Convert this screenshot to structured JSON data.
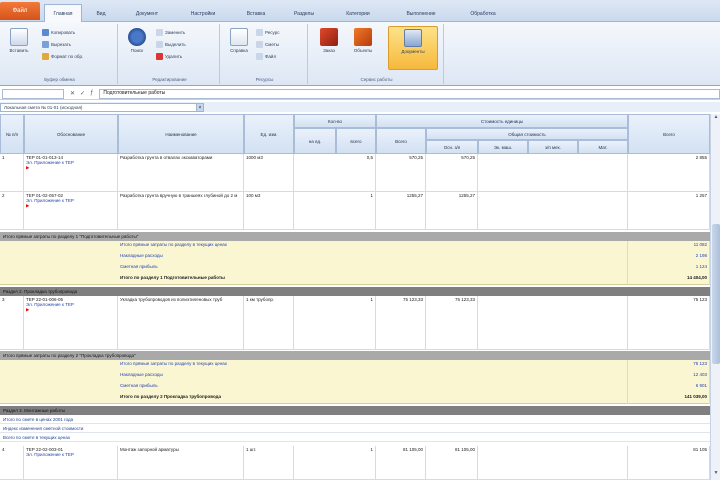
{
  "tabs": [
    "Файл",
    "Главная",
    "Вид",
    "Документ",
    "Настройки",
    "Вставка",
    "Разделы",
    "Категории",
    "Выполнение",
    "Обработка"
  ],
  "ribbon": {
    "groups": [
      {
        "label": "Буфер обмена"
      },
      {
        "label": "Редактирование"
      },
      {
        "label": "Ресурсы"
      },
      {
        "label": "Сервис работы"
      }
    ],
    "clipboard": {
      "paste": "Вставить",
      "small": [
        "Копировать",
        "Вырезать",
        "Формат по обр."
      ]
    },
    "edit": {
      "big": "Поиск",
      "small": [
        "Заменить",
        "Выделить",
        "Удалить"
      ]
    },
    "resources": {
      "big": "Справка",
      "small": [
        "Ресурс",
        "Сметы",
        "Файл"
      ]
    },
    "service": {
      "items": [
        "Заказ",
        "Объекты",
        "Документы"
      ]
    }
  },
  "formula": {
    "cellref": "",
    "text": "Подготовительные работы"
  },
  "sheet_tab": "Локальная смета № 01-01 (исходная)",
  "colors": {
    "gray": "#a9a9a9",
    "yellow": "#fbf6d2",
    "link": "#2142b4",
    "orange": "#f6b93b"
  },
  "columns": [
    "№ п/п",
    "Обоснование",
    "Наименование",
    "Ед. изм.",
    "Кол-во",
    "Стоимость единицы",
    "Общая стоимость",
    "Всего"
  ],
  "subcols": [
    "на ед.",
    "всего",
    "Всего",
    "Осн. з/п",
    "Эк. маш.",
    "з/п мех.",
    "Мат."
  ],
  "rows": [
    {
      "n": "1",
      "code": "ТЕР 01-01-013-14",
      "link": "Эл. Приложение к ТЕР",
      "name": "Разработка грунта в отвалах экскаваторами",
      "unit": "1000 м3",
      "qty": "0,5",
      "price": "570,25",
      "total": "570,25",
      "sum": "2 855"
    },
    {
      "n": "2",
      "code": "ТЕР 01-02-057-02",
      "link": "Эл. Приложение к ТЕР",
      "name": "Разработка грунта вручную в траншеях глубиной до 2 м",
      "unit": "100 м3",
      "qty": "1",
      "price": "1255,27",
      "total": "1255,27",
      "sum": "1 257"
    }
  ],
  "section1": "Итого прямые затраты по разделу 1 \"Подготовительные работы\"",
  "summary1": [
    {
      "label": "Итого прямые затраты по разделу в текущих ценах",
      "value": "11 082"
    },
    {
      "label": "Накладные расходы",
      "value": "2 198"
    },
    {
      "label": "Сметная прибыль",
      "value": "1 124"
    },
    {
      "label": "Итого по разделу 1 Подготовительные работы",
      "value": "14 404,00"
    }
  ],
  "section2": "Раздел 2. Прокладка трубопровода",
  "row3": {
    "n": "3",
    "code": "ТЕР 22-01-006-05",
    "link": "Эл. Приложение к ТЕР",
    "name": "Укладка трубопроводов из полиэтиленовых труб",
    "unit": "1 км трубопр.",
    "qty": "1",
    "price": "75 123,33",
    "total": "75 123,33",
    "sum": "75 123"
  },
  "section2total": "Итого прямые затраты по разделу 2 \"Прокладка трубопровода\"",
  "summary2": [
    {
      "label": "Итого прямые затраты по разделу в текущих ценах",
      "value": "75 123"
    },
    {
      "label": "Накладные расходы",
      "value": "12 403"
    },
    {
      "label": "Сметная прибыль",
      "value": "6 901"
    },
    {
      "label": "Итого по разделу 2 Прокладка трубопровода",
      "value": "141 039,00"
    }
  ],
  "section3": "Раздел 3. Монтажные работы",
  "notes": [
    "Итого по смете в ценах 2001 года",
    "Индекс изменения сметной стоимости",
    "Всего по смете в текущих ценах"
  ],
  "row4": {
    "n": "4",
    "code": "ТЕР 22-02-003-01",
    "link": "Эл. Приложение к ТЕР",
    "name": "Монтаж запорной арматуры",
    "unit": "1 шт.",
    "qty": "1",
    "price": "81 105,00",
    "total": "81 105,00",
    "sum": "81 105"
  }
}
